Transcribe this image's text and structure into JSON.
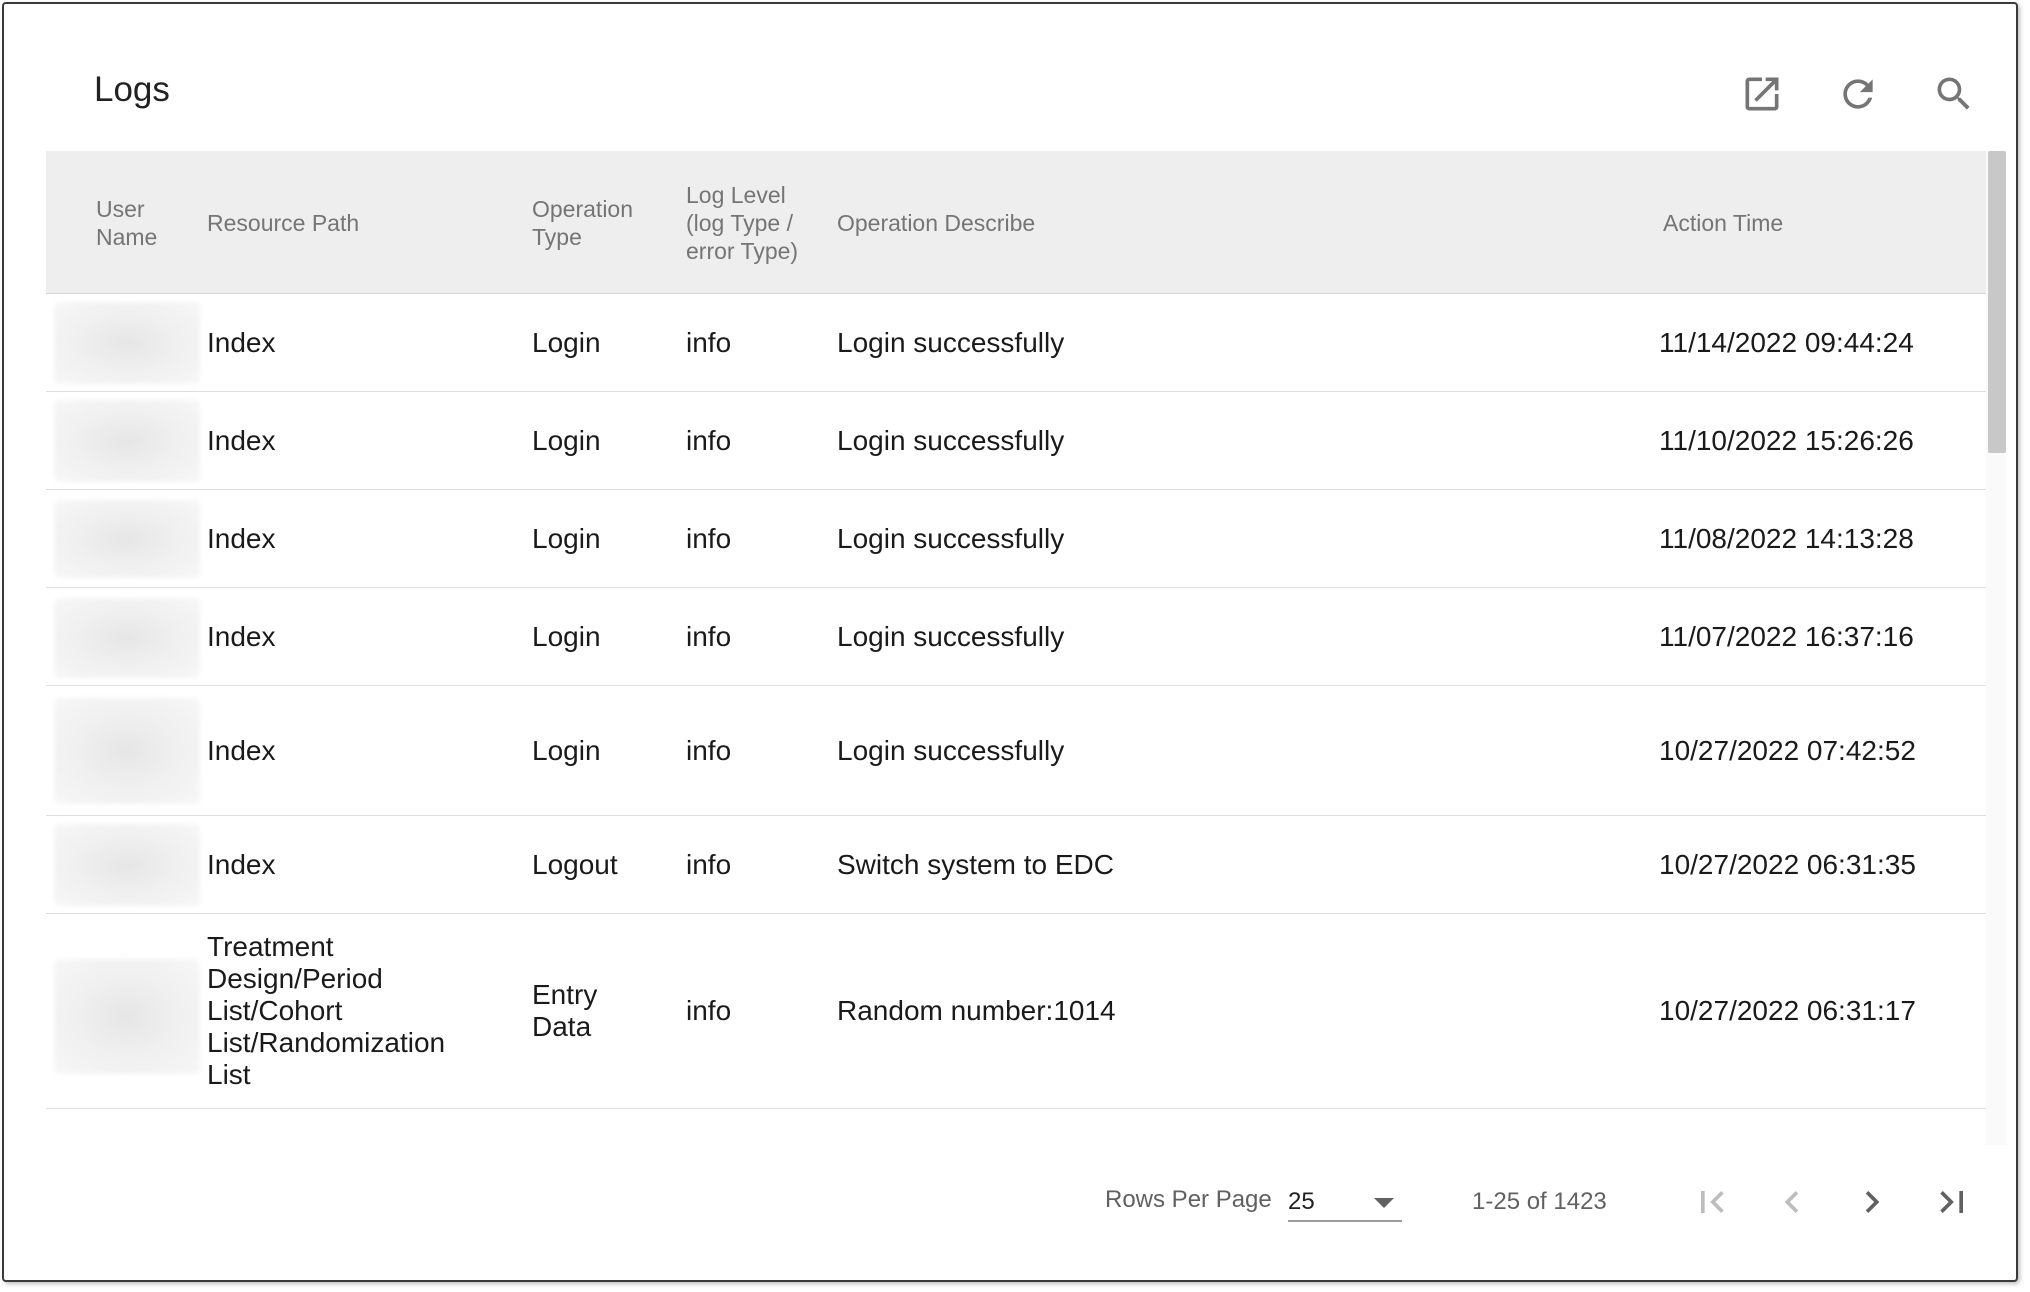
{
  "header": {
    "title": "Logs",
    "icons": [
      "open-in-new-icon",
      "refresh-icon",
      "search-icon"
    ]
  },
  "table": {
    "columns": {
      "user_name": "User Name",
      "resource_path": "Resource Path",
      "operation_type": "Operation Type",
      "log_level": "Log Level (log Type / error Type)",
      "operation_describe": "Operation Describe",
      "action_time": "Action Time"
    },
    "rows": [
      {
        "resource_path": "Index",
        "operation_type": "Login",
        "log_level": "info",
        "operation_describe": "Login successfully",
        "action_time": "11/14/2022 09:44:24"
      },
      {
        "resource_path": "Index",
        "operation_type": "Login",
        "log_level": "info",
        "operation_describe": "Login successfully",
        "action_time": "11/10/2022 15:26:26"
      },
      {
        "resource_path": "Index",
        "operation_type": "Login",
        "log_level": "info",
        "operation_describe": "Login successfully",
        "action_time": "11/08/2022 14:13:28"
      },
      {
        "resource_path": "Index",
        "operation_type": "Login",
        "log_level": "info",
        "operation_describe": "Login successfully",
        "action_time": "11/07/2022 16:37:16"
      },
      {
        "resource_path": "Index",
        "operation_type": "Login",
        "log_level": "info",
        "operation_describe": "Login successfully",
        "action_time": "10/27/2022 07:42:52"
      },
      {
        "resource_path": "Index",
        "operation_type": "Logout",
        "log_level": "info",
        "operation_describe": "Switch system to EDC",
        "action_time": "10/27/2022 06:31:35"
      },
      {
        "resource_path": "Treatment Design/Period List/Cohort List/Randomization List",
        "operation_type": "Entry Data",
        "log_level": "info",
        "operation_describe": "Random number:1014",
        "action_time": "10/27/2022 06:31:17"
      }
    ]
  },
  "pagination": {
    "rows_per_page_label": "Rows Per Page",
    "rows_per_page_value": "25",
    "range_text": "1-25 of 1423",
    "icons": [
      "first-page-icon",
      "previous-page-icon",
      "next-page-icon",
      "last-page-icon"
    ]
  },
  "colors": {
    "header_bg": "#eeeeee",
    "header_text": "#757575",
    "body_text": "#1a1a1a",
    "icon": "#757575",
    "pager_disabled": "#bdbdbd",
    "pager_enabled": "#616161"
  }
}
